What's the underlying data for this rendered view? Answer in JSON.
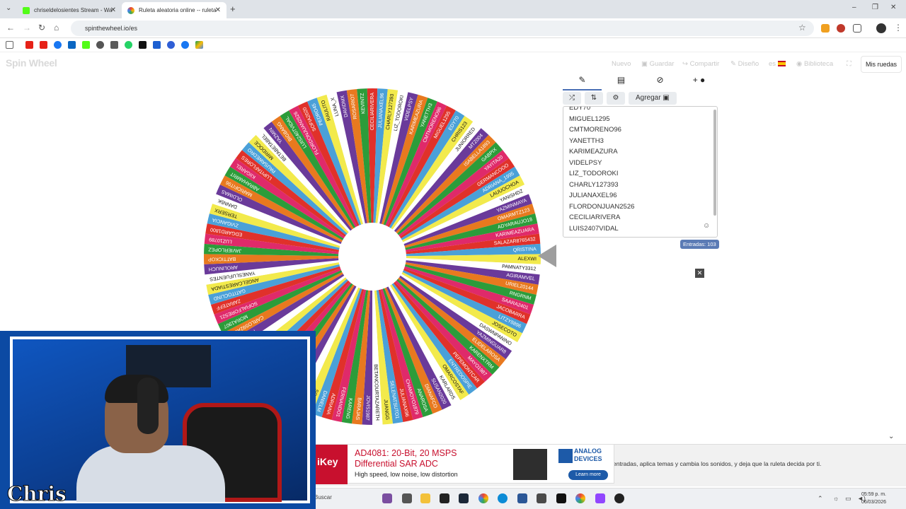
{
  "browser": {
    "tabs": [
      {
        "title": "chriseldelosientes Stream - Wa",
        "favicon_color": "#53fc18"
      },
      {
        "title": "Ruleta aleatoria online -- ruleta",
        "favicon_color": "#ea4335"
      }
    ],
    "new_tab": "+",
    "url": "spinthewheel.io/es",
    "window_controls": [
      "–",
      "❐",
      "✕"
    ]
  },
  "site": {
    "logo": "Spin Wheel",
    "menu": [
      "Nuevo",
      "Guardar",
      "Compartir",
      "Diseño",
      "es",
      "Biblioteca"
    ],
    "my_wheels": "Mis ruedas"
  },
  "panel": {
    "tab_icons": [
      "pencil-icon",
      "clipboard-icon",
      "eye-off-icon",
      "palette-icon"
    ],
    "tab_glyphs": [
      "✎",
      "▤",
      "⊘",
      "+ ●"
    ],
    "tools": [
      "⤮",
      "⇅",
      "⚙",
      "Agregar ▣"
    ],
    "entries": [
      "EDY70",
      "MIGUEL1295",
      "CMTMORENO96",
      "YANETTH3",
      "KARIMEAZURA",
      "VIDELPSY",
      "LIZ_TODOROKI",
      "CHARLY127393",
      "JULIANAXEL96",
      "FLORDONJUAN2526",
      "CECILIARIVERA",
      "LUIS2407VIDAL"
    ],
    "emoji_glyph": "☺",
    "entries_badge": "Entradas: 103",
    "close_glyph": "✕"
  },
  "wheel_colors": [
    "#e0312a",
    "#4aa0d8",
    "#f2ea4c",
    "#ffffff",
    "#6a3a9a",
    "#e8791f",
    "#2c9c3a",
    "#df2a6a"
  ],
  "wheel_labels": [
    "CECILIARIVERA",
    "JULIANAXEL96",
    "CHARLY127393",
    "LIZ_TODOROKI",
    "VIDELPSY",
    "KARIMEAZURA",
    "YANETTH3",
    "CMTMORENO96",
    "MIGUEL1295",
    "EDY70",
    "CHRIS123",
    "JUNIORRED",
    "MTZ004",
    "ISABELLA1893",
    "GABPIX",
    "YAYITA20",
    "GERMANCOOO",
    "ADRIANA_1995",
    "LAUUOCHOA",
    "YANISHDZ",
    "YAZMINMAYA",
    "OMARMTZ123",
    "ADYARAUJO18",
    "KARIMEAZUARA",
    "SALAZAR8765432",
    "QRISTINA",
    "ALEXWI",
    "PAMNATY3312",
    "AGIRAMVEL",
    "URIEL20144",
    "RNGRNM",
    "SAARA2401",
    "JACOBARRA",
    "LITZY8896",
    "JOSECOTO",
    "DASWNPANINO",
    "YAZMINGUAR8",
    "ELIDELAROSA",
    "KARENXTRM",
    "MAYO1987",
    "PEPEMONTCAR",
    "ENTREDOSPIE",
    "OMARCOSTAF",
    "KARLARDS",
    "SUSAN2020",
    "DIANAFCO",
    "ANAROSA",
    "CHAMOYO1879",
    "JULIANAX96",
    "SELENATSUTO1",
    "JUANGG",
    "BETANCOURTAZARETH",
    "JOVIS1987",
    "BARAJAS",
    "KARENG",
    "FERNANDO1",
    "ADRIANA",
    "DANIELM",
    "SOFIA12",
    "MARIO88",
    "LUCAS7",
    "NAYCAMA",
    "RICKMAR",
    "LVARKK",
    "BRYANWALLS",
    "YIZ2309",
    "MACO2008",
    "ANAHI1994",
    "FIDERUIZ1",
    "CARLOS92AVILA",
    "MORA1907",
    "SOFIALFORES21",
    "ZARATEFF",
    "GATITOCLIND",
    "ANGELCARESTIADA",
    "YANESLUFUENTES",
    "AROLINUCH",
    "BATTICKOP",
    "JAVIERLOPEZ",
    "LUZ10789",
    "EDGARD1800",
    "ZVIGANCIA",
    "TERSERX",
    "DANN5K",
    "OLDIMAS",
    "MARIOFIT96",
    "ABRAHAMRIT",
    "KIIGAREL",
    "LUPITAFLORES",
    "PAUSAWEDRO",
    "MIRIDOCE",
    "BETABETABEL",
    "YAZMIN",
    "BIGBANG",
    "LUIS2407VIDAL",
    "FLORDONJUAN2526",
    "SOFIA2020",
    "PEDRO45",
    "RAULITO",
    "LUNA_X",
    "DAVIDMX",
    "ROSARIO7",
    "KEVINTZ"
  ]
}
